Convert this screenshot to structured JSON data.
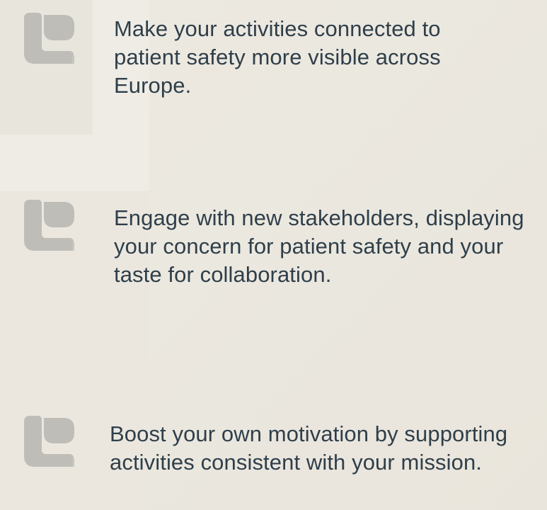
{
  "colors": {
    "background": "#ebe7df",
    "icon": "#bfbdb8",
    "text": "#2f3f4a"
  },
  "benefits": [
    {
      "icon": "heart-shape-icon",
      "text": "Make your activities connected to patient safety more visible across Europe."
    },
    {
      "icon": "heart-shape-icon",
      "text": "Engage with new stakeholders, displaying your concern for patient safety and your taste for collaboration."
    },
    {
      "icon": "heart-shape-icon",
      "text": "Boost your own motivation by supporting activities consistent with your mission."
    }
  ]
}
